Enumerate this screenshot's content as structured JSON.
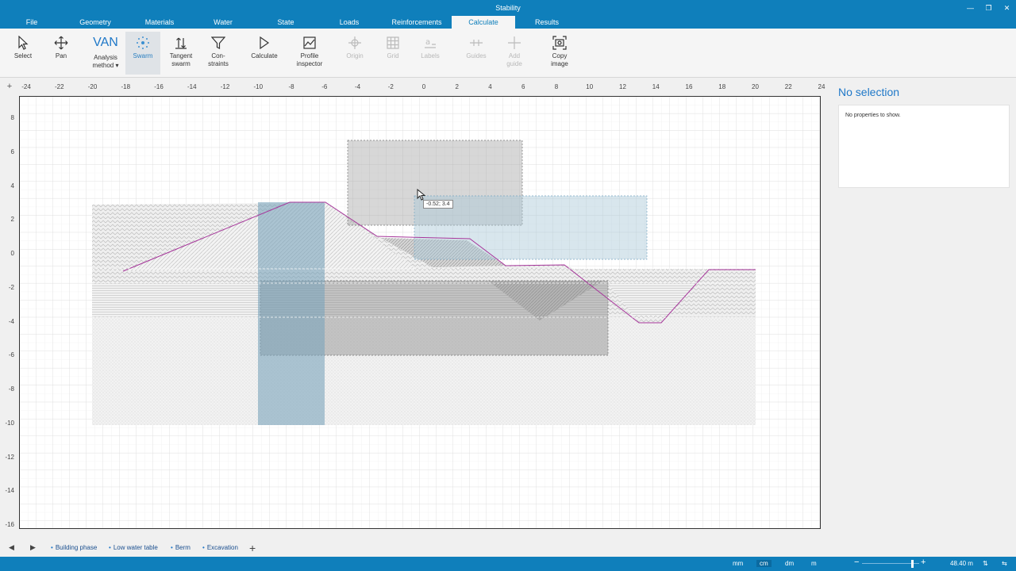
{
  "app": {
    "title": "Stability"
  },
  "window_controls": [
    "—",
    "❐",
    "✕"
  ],
  "menu_tabs": [
    "File",
    "Geometry",
    "Materials",
    "Water",
    "State",
    "Loads",
    "Reinforcements",
    "Calculate",
    "Results"
  ],
  "active_menu_tab": "Calculate",
  "ribbon": {
    "select": "Select",
    "pan": "Pan",
    "analysis_method_icon_text": "VAN",
    "analysis_method_line1": "Analysis",
    "analysis_method_line2": "method ▾",
    "swarm": "Swarm",
    "tangent_line1": "Tangent",
    "tangent_line2": "swarm",
    "constraints_line1": "Con-",
    "constraints_line2": "straints",
    "calculate": "Calculate",
    "profile_line1": "Profile",
    "profile_line2": "inspector",
    "origin": "Origin",
    "grid": "Grid",
    "labels": "Labels",
    "guides": "Guides",
    "add_guide_line1": "Add",
    "add_guide_line2": "guide",
    "copy_image_line1": "Copy",
    "copy_image_line2": "image"
  },
  "rulers": {
    "x_ticks": [
      "-24",
      "-22",
      "-20",
      "-18",
      "-16",
      "-14",
      "-12",
      "-10",
      "-8",
      "-6",
      "-4",
      "-2",
      "0",
      "2",
      "4",
      "6",
      "8",
      "10",
      "12",
      "14",
      "16",
      "18",
      "20",
      "22",
      "24"
    ],
    "y_ticks": [
      "8",
      "6",
      "4",
      "2",
      "0",
      "-2",
      "-4",
      "-6",
      "-8",
      "-10",
      "-12",
      "-14",
      "-16"
    ],
    "corner": "+"
  },
  "canvas": {
    "coord_tooltip": "-0.52; 3.4"
  },
  "properties": {
    "title": "No selection",
    "message": "No properties to show."
  },
  "stages": [
    "Building phase",
    "Low water table",
    "Berm",
    "Excavation"
  ],
  "status": {
    "units": [
      "mm",
      "cm",
      "dm",
      "m"
    ],
    "active_unit": "cm",
    "scale": "48.40 m"
  },
  "colors": {
    "accent": "#0f7fbb",
    "slip_line": "#a6359a",
    "tangent_area": "#9ab9c9"
  }
}
